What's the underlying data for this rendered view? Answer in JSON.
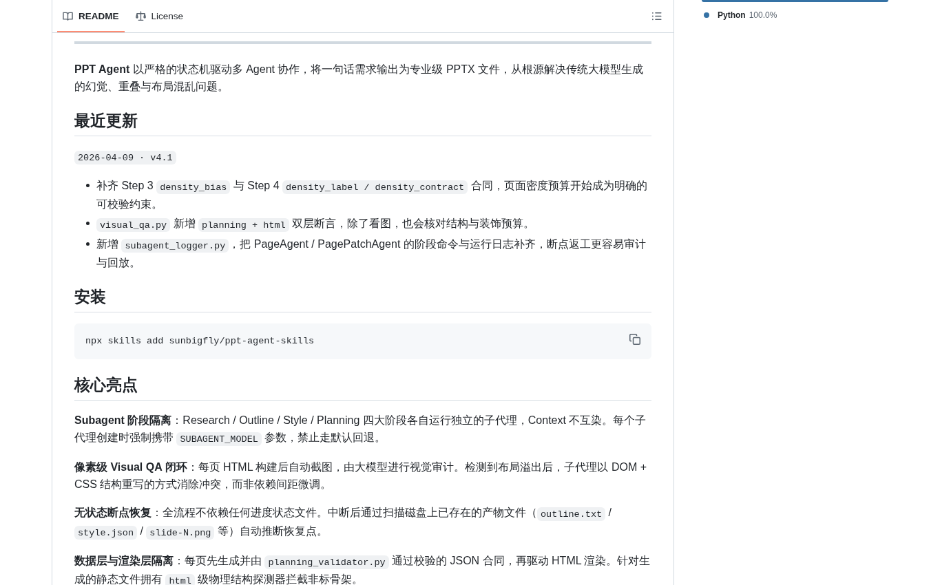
{
  "tabs": [
    {
      "kind": "readme",
      "label": "README",
      "selected": true
    },
    {
      "kind": "license",
      "label": "License",
      "selected": false
    }
  ],
  "readme": {
    "blocks": [
      {
        "kind": "rule"
      },
      {
        "kind": "paragraph",
        "parts": [
          {
            "kind": "text",
            "text": "**PPT Agent** 以严格的状态机驱动多 Agent 协作，将一句话需求输出为专业级 PPTX 文件，从根源解决传统大模型生成的幻觉、重叠与布局混乱问题。"
          }
        ]
      },
      {
        "kind": "heading",
        "text": "最近更新"
      },
      {
        "kind": "paragraph",
        "parts": [
          {
            "kind": "code",
            "text": "2026-04-09 · v4.1"
          }
        ]
      },
      {
        "kind": "list",
        "items": [
          {
            "parts": [
              {
                "kind": "text",
                "text": "补齐 Step 3 "
              },
              {
                "kind": "code",
                "text": "density_bias"
              },
              {
                "kind": "text",
                "text": " 与 Step 4 "
              },
              {
                "kind": "code",
                "text": "density_label / density_contract"
              },
              {
                "kind": "text",
                "text": " 合同，页面密度预算开始成为明确的可校验约束。"
              }
            ]
          },
          {
            "parts": [
              {
                "kind": "code",
                "text": "visual_qa.py"
              },
              {
                "kind": "text",
                "text": " 新增 "
              },
              {
                "kind": "code",
                "text": "planning + html"
              },
              {
                "kind": "text",
                "text": " 双层断言，除了看图，也会核对结构与装饰预算。"
              }
            ]
          },
          {
            "parts": [
              {
                "kind": "text",
                "text": "新增 "
              },
              {
                "kind": "code",
                "text": "subagent_logger.py"
              },
              {
                "kind": "text",
                "text": "，把 PageAgent / PagePatchAgent 的阶段命令与运行日志补齐，断点返工更容易审计与回放。"
              }
            ]
          }
        ]
      },
      {
        "kind": "heading",
        "text": "安装"
      },
      {
        "kind": "codeblock",
        "text": "npx skills add sunbigfly/ppt-agent-skills"
      },
      {
        "kind": "heading",
        "text": "核心亮点"
      },
      {
        "kind": "paragraph",
        "parts": [
          {
            "kind": "text",
            "text": "**Subagent 阶段隔离**：Research / Outline / Style / Planning 四大阶段各自运行独立的子代理，Context 不互染。每个子代理创建时强制携带 "
          },
          {
            "kind": "code",
            "text": "SUBAGENT_MODEL"
          },
          {
            "kind": "text",
            "text": " 参数，禁止走默认回退。"
          }
        ]
      },
      {
        "kind": "paragraph",
        "parts": [
          {
            "kind": "text",
            "text": "**像素级 Visual QA 闭环**：每页 HTML 构建后自动截图，由大模型进行视觉审计。检测到布局溢出后，子代理以 DOM + CSS 结构重写的方式消除冲突，而非依赖间距微调。"
          }
        ]
      },
      {
        "kind": "paragraph",
        "parts": [
          {
            "kind": "text",
            "text": "**无状态断点恢复**：全流程不依赖任何进度状态文件。中断后通过扫描磁盘上已存在的产物文件（"
          },
          {
            "kind": "code",
            "text": "outline.txt"
          },
          {
            "kind": "text",
            "text": " / "
          },
          {
            "kind": "code",
            "text": "style.json"
          },
          {
            "kind": "text",
            "text": " / "
          },
          {
            "kind": "code",
            "text": "slide-N.png"
          },
          {
            "kind": "text",
            "text": " 等）自动推断恢复点。"
          }
        ]
      },
      {
        "kind": "paragraph",
        "parts": [
          {
            "kind": "text",
            "text": "**数据层与渲染层隔离**：每页先生成并由 "
          },
          {
            "kind": "code",
            "text": "planning_validator.py"
          },
          {
            "kind": "text",
            "text": " 通过校验的 JSON 合同，再驱动 HTML 渲染。针对生成的静态文件拥有 "
          },
          {
            "kind": "code",
            "text": "html"
          },
          {
            "kind": "text",
            "text": " 级物理结构探测器拦截非标骨架。"
          }
        ]
      }
    ]
  },
  "languages": [
    {
      "name": "Python",
      "percent": "100.0%",
      "color": "#3572a5"
    }
  ]
}
